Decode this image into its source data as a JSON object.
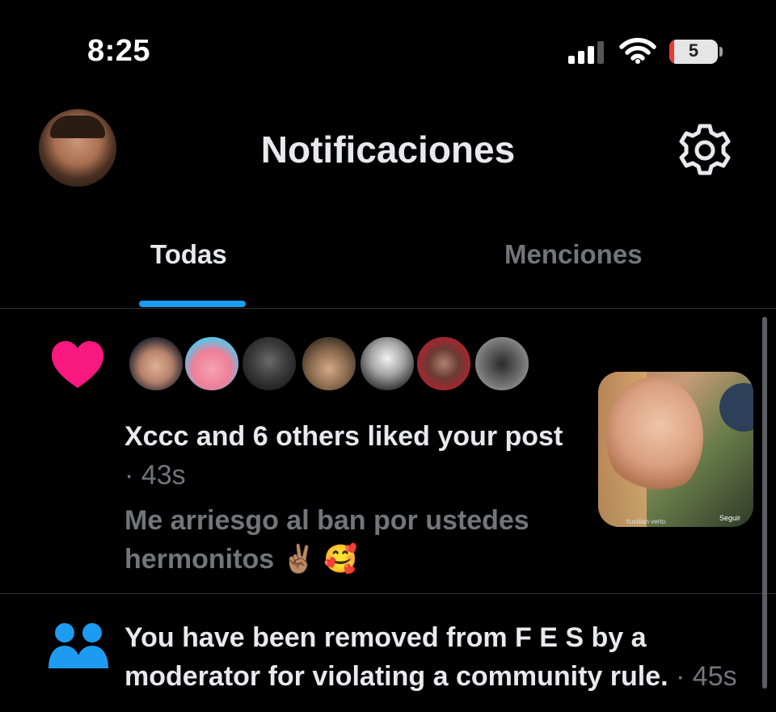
{
  "status_bar": {
    "time": "8:25",
    "battery_level": "5",
    "battery_color": "#ea3b35"
  },
  "header": {
    "title": "Notificaciones",
    "avatar": "profile-photo",
    "settings_icon": "gear-icon"
  },
  "tabs": [
    {
      "label": "Todas",
      "active": true
    },
    {
      "label": "Menciones",
      "active": false
    }
  ],
  "colors": {
    "accent": "#1d9bf0",
    "like": "#f91880",
    "muted": "#71767b",
    "text": "#e7e9ea"
  },
  "notifications": [
    {
      "type": "like",
      "icon": "heart-icon",
      "actor_count_avatars": 7,
      "text": "Xccc and 6 others liked your post",
      "separator": "·",
      "time": "43s",
      "preview": "Me arriesgo al ban por ustedes hermonitos ✌🏽 🥰",
      "thumbnail": "video-thumbnail",
      "thumbnail_follow_label": "Seguir",
      "thumbnail_caption": "Yuridian verto."
    },
    {
      "type": "community",
      "icon": "people-icon",
      "text": "You have been removed from F E S by a moderator for violating a community rule.",
      "separator": "·",
      "time": "45s"
    }
  ]
}
